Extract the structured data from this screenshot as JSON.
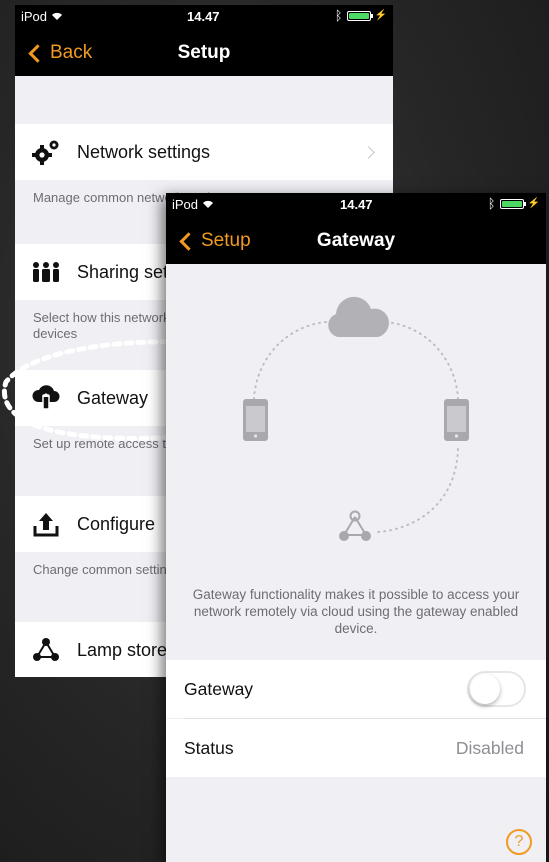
{
  "back_screen": {
    "status": {
      "carrier": "iPod",
      "time": "14.47"
    },
    "nav": {
      "back_label": "Back",
      "title": "Setup"
    },
    "items": [
      {
        "label": "Network settings",
        "desc": "Manage common network settings",
        "icon": "gears-icon"
      },
      {
        "label": "Sharing settings",
        "desc": "Select how this network is shared with other mobile devices",
        "icon": "people-icon"
      },
      {
        "label": "Gateway",
        "desc": "Set up remote access to the network via this device.",
        "icon": "cloud-upload-icon"
      },
      {
        "label": "Configure",
        "desc": "Change common settings for the network.",
        "icon": "upload-icon"
      },
      {
        "label": "Lamp store",
        "icon": "network-nodes-icon"
      }
    ]
  },
  "front_screen": {
    "status": {
      "carrier": "iPod",
      "time": "14.47"
    },
    "nav": {
      "back_label": "Setup",
      "title": "Gateway"
    },
    "description": "Gateway functionality makes it possible to access your network remotely via cloud using the gateway enabled device.",
    "gateway_row": {
      "label": "Gateway",
      "toggle_on": false
    },
    "status_row": {
      "label": "Status",
      "value": "Disabled"
    },
    "help_label": "?"
  },
  "colors": {
    "accent": "#f09a23",
    "battery": "#4cd964"
  }
}
